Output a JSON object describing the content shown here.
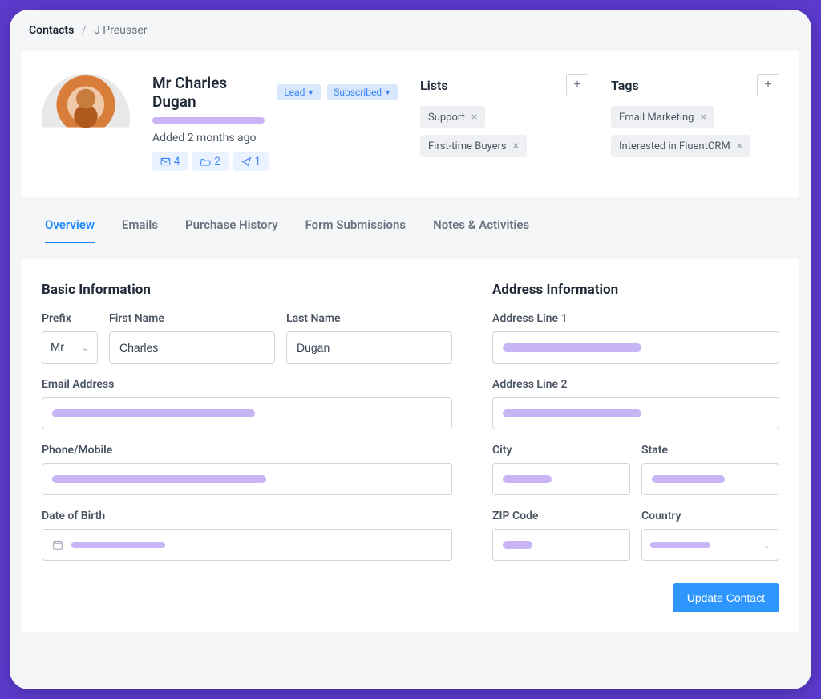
{
  "breadcrumb": {
    "root": "Contacts",
    "current": "J Preusser"
  },
  "profile": {
    "name": "Mr Charles Dugan",
    "type_badge": "Lead",
    "status_badge": "Subscribed",
    "added_text": "Added 2 months ago",
    "stats": {
      "emails": "4",
      "folders": "2",
      "sends": "1"
    }
  },
  "lists": {
    "title": "Lists",
    "items": [
      "Support",
      "First-time Buyers"
    ]
  },
  "tags": {
    "title": "Tags",
    "items": [
      "Email Marketing",
      "Interested in FluentCRM"
    ]
  },
  "tabs": [
    "Overview",
    "Emails",
    "Purchase History",
    "Form Submissions",
    "Notes & Activities"
  ],
  "active_tab": "Overview",
  "form": {
    "basic": {
      "title": "Basic Information",
      "prefix_label": "Prefix",
      "prefix_value": "Mr",
      "first_name_label": "First Name",
      "first_name_value": "Charles",
      "last_name_label": "Last Name",
      "last_name_value": "Dugan",
      "email_label": "Email Address",
      "phone_label": "Phone/Mobile",
      "dob_label": "Date of Birth"
    },
    "address": {
      "title": "Address Information",
      "line1_label": "Address Line 1",
      "line2_label": "Address Line 2",
      "city_label": "City",
      "state_label": "State",
      "zip_label": "ZIP Code",
      "country_label": "Country"
    },
    "submit_label": "Update Contact"
  }
}
